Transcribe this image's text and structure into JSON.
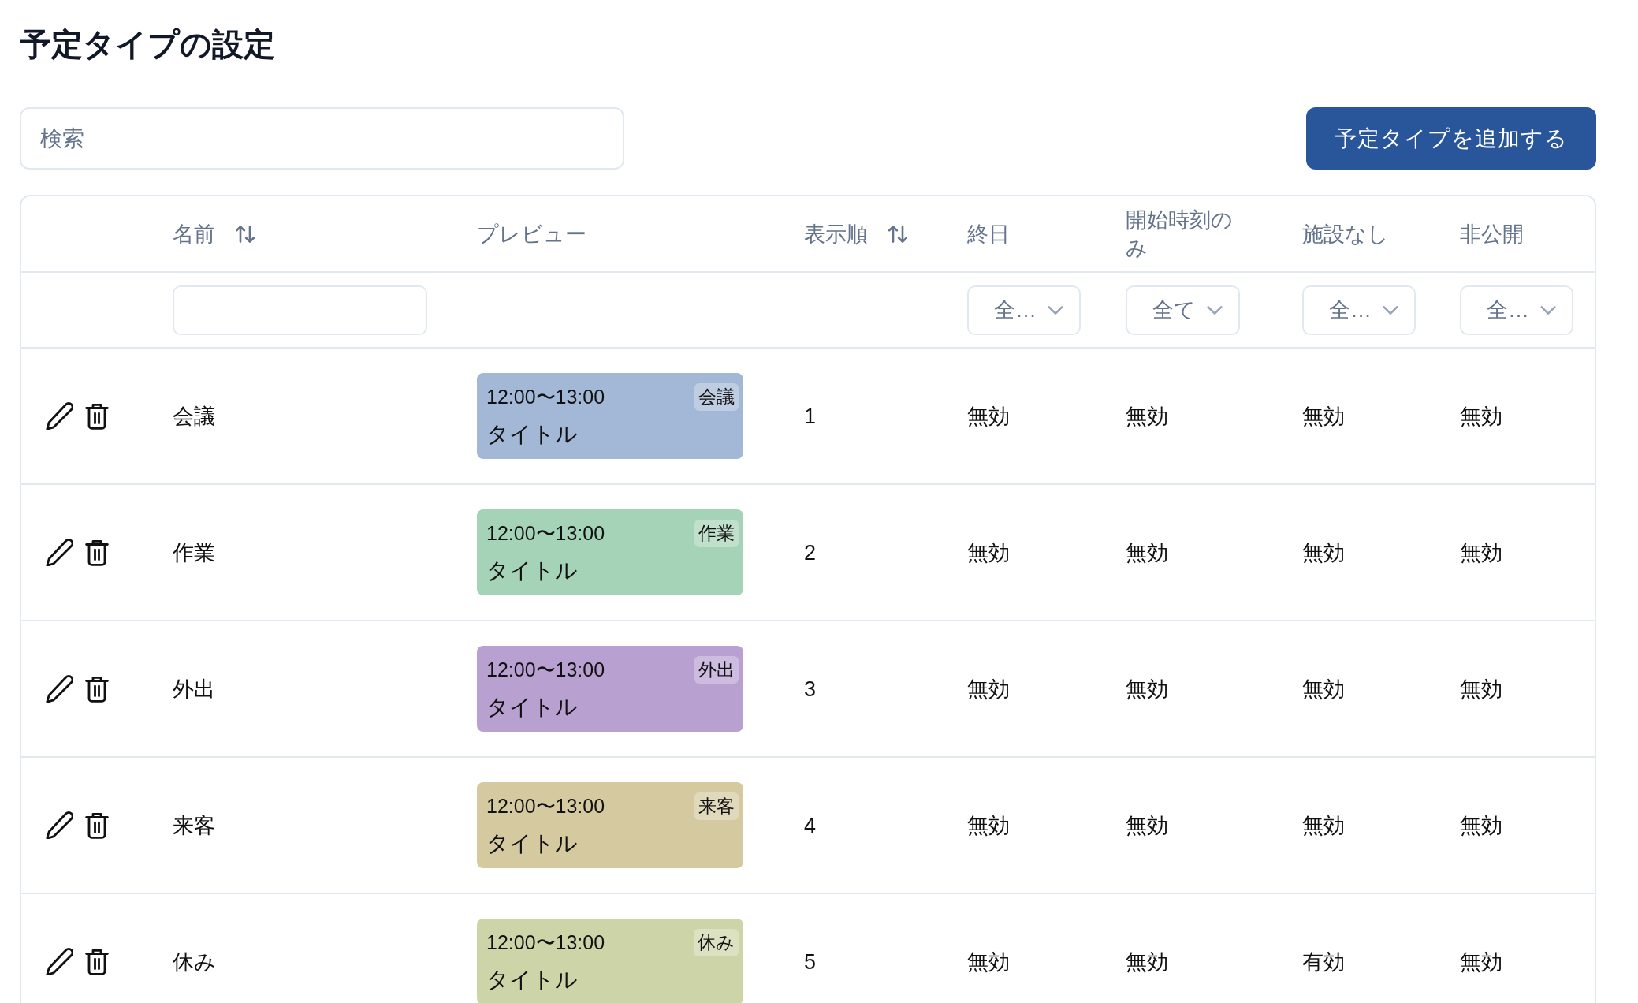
{
  "page": {
    "title": "予定タイプの設定"
  },
  "search": {
    "placeholder": "検索"
  },
  "add_button": {
    "label": "予定タイプを追加する"
  },
  "table": {
    "columns": [
      {
        "label": "名前",
        "sortable": true,
        "filter": {
          "kind": "text"
        }
      },
      {
        "label": "プレビュー",
        "sortable": false
      },
      {
        "label": "表示順",
        "sortable": true
      },
      {
        "label": "終日",
        "sortable": false,
        "filter": {
          "kind": "select",
          "value": "全…"
        }
      },
      {
        "label": "開始時刻のみ",
        "sortable": false,
        "filter": {
          "kind": "select",
          "value": "全て"
        }
      },
      {
        "label": "施設なし",
        "sortable": false,
        "filter": {
          "kind": "select",
          "value": "全…"
        }
      },
      {
        "label": "非公開",
        "sortable": false,
        "filter": {
          "kind": "select",
          "value": "全…"
        }
      }
    ],
    "rows": [
      {
        "name": "会議",
        "preview": {
          "time": "12:00〜13:00",
          "badge": "会議",
          "title": "タイトル",
          "color": "#a3b8d6"
        },
        "order": "1",
        "all_day": "無効",
        "start_time_only": "無効",
        "no_facility": "無効",
        "private": "無効"
      },
      {
        "name": "作業",
        "preview": {
          "time": "12:00〜13:00",
          "badge": "作業",
          "title": "タイトル",
          "color": "#a5d3b7"
        },
        "order": "2",
        "all_day": "無効",
        "start_time_only": "無効",
        "no_facility": "無効",
        "private": "無効"
      },
      {
        "name": "外出",
        "preview": {
          "time": "12:00〜13:00",
          "badge": "外出",
          "title": "タイトル",
          "color": "#b8a0d1"
        },
        "order": "3",
        "all_day": "無効",
        "start_time_only": "無効",
        "no_facility": "無効",
        "private": "無効"
      },
      {
        "name": "来客",
        "preview": {
          "time": "12:00〜13:00",
          "badge": "来客",
          "title": "タイトル",
          "color": "#d5c9a0"
        },
        "order": "4",
        "all_day": "無効",
        "start_time_only": "無効",
        "no_facility": "無効",
        "private": "無効"
      },
      {
        "name": "休み",
        "preview": {
          "time": "12:00〜13:00",
          "badge": "休み",
          "title": "タイトル",
          "color": "#cdd5a8"
        },
        "order": "5",
        "all_day": "無効",
        "start_time_only": "無効",
        "no_facility": "有効",
        "private": "無効"
      }
    ]
  }
}
